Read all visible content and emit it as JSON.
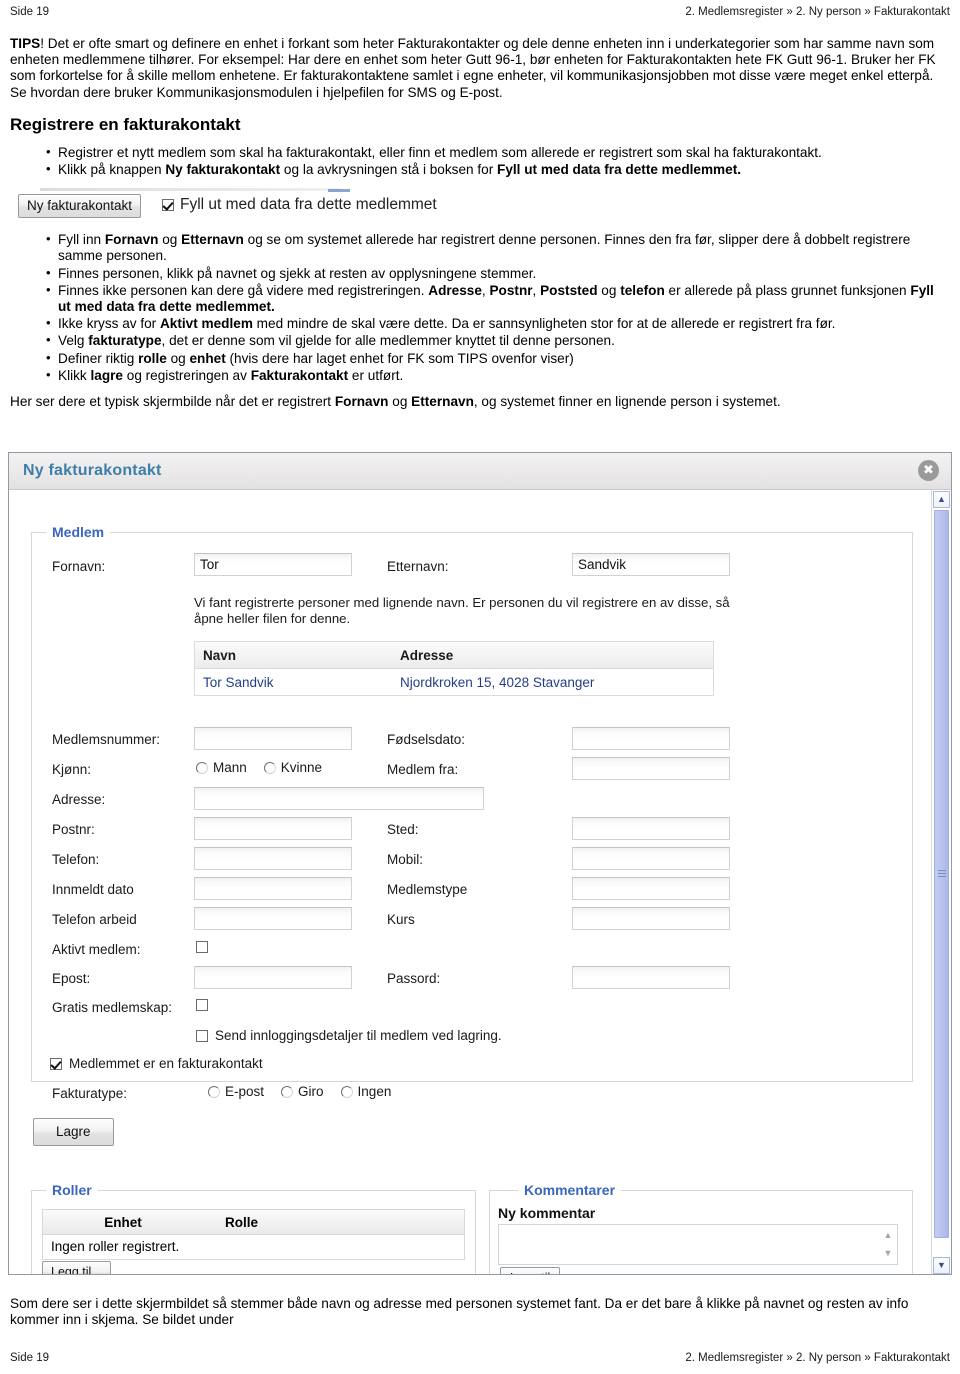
{
  "page": {
    "header_left": "Side 19",
    "header_right": "2. Medlemsregister » 2. Ny person » Fakturakontakt",
    "footer_left": "Side 19",
    "footer_right": "2. Medlemsregister » 2. Ny person » Fakturakontakt"
  },
  "tips": {
    "label": "TIPS",
    "text": "! Det er ofte smart og definere en enhet i forkant som heter Fakturakontakter og dele denne enheten inn i underkategorier som har samme navn som enheten medlemmene tilhører. For eksempel: Har dere en enhet som heter Gutt 96-1, bør enheten for Fakturakontakten hete FK Gutt 96-1. Bruker her FK som forkortelse for å skille mellom enhetene. Er fakturakontaktene samlet i egne enheter, vil kommunikasjonsjobben mot disse være meget enkel etterpå. Se hvordan dere bruker Kommunikasjonsmodulen i hjelpefilen for SMS og E-post."
  },
  "section": {
    "title": "Registrere en fakturakontakt",
    "bullet1": "Registrer et nytt medlem som skal ha fakturakontakt, eller finn et medlem som allerede er registrert som skal ha fakturakontakt.",
    "bullet2_a": "Klikk på knappen ",
    "bullet2_b": "Ny fakturakontakt",
    "bullet2_c": " og la avkrysningen stå i boksen for ",
    "bullet2_d": "Fyll ut med data fra dette medlemmet."
  },
  "inline_shot": {
    "button_label": "Ny fakturakontakt",
    "checkbox_label": "Fyll ut med data fra dette medlemmet",
    "checkbox_checked": "true"
  },
  "bullets2": [
    {
      "parts": [
        {
          "t": "Fyll inn ",
          "b": false
        },
        {
          "t": "Fornavn",
          "b": true
        },
        {
          "t": " og ",
          "b": false
        },
        {
          "t": "Etternavn",
          "b": true
        },
        {
          "t": " og se om systemet allerede har registrert denne personen. Finnes den fra før, slipper dere å dobbelt registrere samme personen.",
          "b": false
        }
      ]
    },
    {
      "parts": [
        {
          "t": "Finnes personen, klikk på navnet og sjekk at resten av opplysningene stemmer.",
          "b": false
        }
      ]
    },
    {
      "parts": [
        {
          "t": "Finnes ikke personen kan dere gå videre med registreringen. ",
          "b": false
        },
        {
          "t": "Adresse",
          "b": true
        },
        {
          "t": ", ",
          "b": false
        },
        {
          "t": "Postnr",
          "b": true
        },
        {
          "t": ", ",
          "b": false
        },
        {
          "t": "Poststed",
          "b": true
        },
        {
          "t": " og ",
          "b": false
        },
        {
          "t": "telefon",
          "b": true
        },
        {
          "t": " er allerede på plass grunnet funksjonen ",
          "b": false
        },
        {
          "t": "Fyll ut med data fra dette medlemmet.",
          "b": true
        }
      ]
    },
    {
      "parts": [
        {
          "t": "Ikke kryss av for ",
          "b": false
        },
        {
          "t": "Aktivt medlem",
          "b": true
        },
        {
          "t": " med mindre de skal være dette. Da er sannsynligheten stor for at de allerede er registrert fra før.",
          "b": false
        }
      ]
    },
    {
      "parts": [
        {
          "t": "Velg ",
          "b": false
        },
        {
          "t": "fakturatype",
          "b": true
        },
        {
          "t": ", det er denne som vil gjelde for alle medlemmer knyttet til denne personen.",
          "b": false
        }
      ]
    },
    {
      "parts": [
        {
          "t": "Definer riktig ",
          "b": false
        },
        {
          "t": "rolle",
          "b": true
        },
        {
          "t": " og ",
          "b": false
        },
        {
          "t": "enhet",
          "b": true
        },
        {
          "t": " (hvis dere har laget enhet for FK som TIPS ovenfor viser)",
          "b": false
        }
      ]
    },
    {
      "parts": [
        {
          "t": "Klikk ",
          "b": false
        },
        {
          "t": "lagre",
          "b": true
        },
        {
          "t": " og registreringen av ",
          "b": false
        },
        {
          "t": "Fakturakontakt",
          "b": true
        },
        {
          "t": " er utført.",
          "b": false
        }
      ]
    }
  ],
  "intro_after_bullets": {
    "parts": [
      {
        "t": "Her ser dere et typisk skjermbilde når det er registrert ",
        "b": false
      },
      {
        "t": "Fornavn",
        "b": true
      },
      {
        "t": " og ",
        "b": false
      },
      {
        "t": "Etternavn",
        "b": true
      },
      {
        "t": ", og systemet finner en lignende person i systemet.",
        "b": false
      }
    ]
  },
  "dialog": {
    "title": "Ny fakturakontakt",
    "close_icon": "✖",
    "fieldset_medlem_legend": "Medlem",
    "fields": {
      "fornavn_label": "Fornavn:",
      "fornavn_value": "Tor",
      "etternavn_label": "Etternavn:",
      "etternavn_value": "Sandvik",
      "hint_text": "Vi fant registrerte personer med lignende navn. Er personen du vil registrere en av disse, så åpne heller filen for denne.",
      "medlemsnummer_label": "Medlemsnummer:",
      "medlemsnummer_value": "",
      "fodselsdato_label": "Fødselsdato:",
      "fodselsdato_value": "",
      "kjonn_label": "Kjønn:",
      "kjonn_option_1": "Mann",
      "kjonn_option_2": "Kvinne",
      "medlem_fra_label": "Medlem fra:",
      "medlem_fra_value": "",
      "adresse_label": "Adresse:",
      "adresse_value": "",
      "postnr_label": "Postnr:",
      "postnr_value": "",
      "sted_label": "Sted:",
      "sted_value": "",
      "telefon_label": "Telefon:",
      "telefon_value": "",
      "mobil_label": "Mobil:",
      "mobil_value": "",
      "innmeldt_dato_label": "Innmeldt dato",
      "innmeldt_dato_value": "",
      "medlemstype_label": "Medlemstype",
      "medlemstype_value": "",
      "telefon_arbeid_label": "Telefon arbeid",
      "telefon_arbeid_value": "",
      "kurs_label": "Kurs",
      "kurs_value": "",
      "aktivt_medlem_label": "Aktivt medlem:",
      "epost_label": "Epost:",
      "epost_value": "",
      "passord_label": "Passord:",
      "passord_value": "",
      "gratis_medlemskap_label": "Gratis medlemskap:",
      "send_innlogging_label": "Send innloggingsdetaljer til medlem ved lagring.",
      "er_fakturakontakt_label": "Medlemmet er en fakturakontakt",
      "fakturatype_label": "Fakturatype:",
      "fakturatype_option_1": "E-post",
      "fakturatype_option_2": "Giro",
      "fakturatype_option_3": "Ingen"
    },
    "results": {
      "col_navn": "Navn",
      "col_adresse": "Adresse",
      "rows": [
        {
          "navn": "Tor Sandvik",
          "adresse": "Njordkroken 15, 4028 Stavanger"
        }
      ]
    },
    "save_button": "Lagre",
    "roller": {
      "legend": "Roller",
      "col_enhet": "Enhet",
      "col_rolle": "Rolle",
      "empty_text": "Ingen roller registrert.",
      "add_button": "Legg til..."
    },
    "kommentarer": {
      "legend": "Kommentarer",
      "new_label": "Ny kommentar",
      "textarea_value": "",
      "add_button": "Legg til"
    },
    "scrollbar": {
      "up_arrow": "▲",
      "down_arrow": "▼"
    }
  },
  "closing": {
    "text": "Som dere ser i dette skjermbildet så stemmer både navn og adresse med personen systemet fant. Da er det bare å klikke på navnet og resten av info kommer inn i skjema. Se bildet under"
  },
  "colors": {
    "legend_blue": "#3a66c0",
    "title_blue": "#3e7faa",
    "link_blue": "#243f86",
    "scrollbar_thumb": "#b9c4ee"
  }
}
